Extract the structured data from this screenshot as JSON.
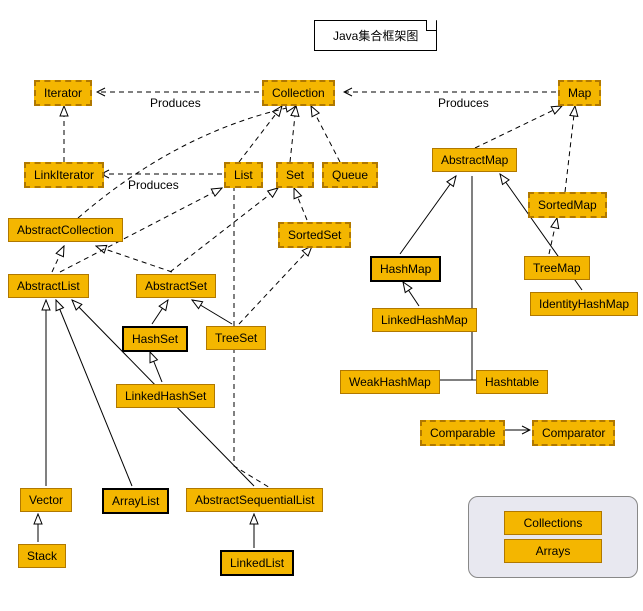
{
  "title": "Java集合框架图",
  "labels": {
    "produces1": "Produces",
    "produces2": "Produces",
    "produces3": "Produces"
  },
  "nodes": {
    "Iterator": "Iterator",
    "Collection": "Collection",
    "Map": "Map",
    "LinkIterator": "LinkIterator",
    "List": "List",
    "Set": "Set",
    "Queue": "Queue",
    "AbstractMap": "AbstractMap",
    "SortedMap": "SortedMap",
    "AbstractCollection": "AbstractCollection",
    "SortedSet": "SortedSet",
    "HashMap": "HashMap",
    "TreeMap": "TreeMap",
    "IdentityHashMap": "IdentityHashMap",
    "AbstractList": "AbstractList",
    "AbstractSet": "AbstractSet",
    "LinkedHashMap": "LinkedHashMap",
    "HashSet": "HashSet",
    "TreeSet": "TreeSet",
    "WeakHashMap": "WeakHashMap",
    "Hashtable": "Hashtable",
    "LinkedHashSet": "LinkedHashSet",
    "Comparable": "Comparable",
    "Comparator": "Comparator",
    "Vector": "Vector",
    "ArrayList": "ArrayList",
    "AbstractSequentialList": "AbstractSequentialList",
    "Stack": "Stack",
    "LinkedList": "LinkedList"
  },
  "legend": {
    "Collections": "Collections",
    "Arrays": "Arrays"
  }
}
